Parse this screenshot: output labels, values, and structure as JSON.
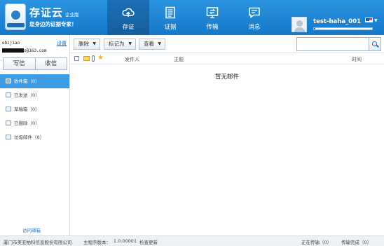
{
  "brand": {
    "name": "存证云",
    "edition": "企业版",
    "slogan": "您身边的证据专家！"
  },
  "nav": [
    {
      "label": "存证",
      "icon": "cloud-upload-icon",
      "active": true
    },
    {
      "label": "证据",
      "icon": "document-icon",
      "active": false
    },
    {
      "label": "传输",
      "icon": "transfer-monitor-icon",
      "active": false
    },
    {
      "label": "消息",
      "icon": "message-icon",
      "active": false
    }
  ],
  "user": {
    "name": "test-haha_001",
    "quota_fraction": 0.03
  },
  "sidebar": {
    "account": "ebijiao",
    "settings_label": "设置",
    "email_suffix": "o@163.com",
    "write_label": "写信",
    "receive_label": "收信",
    "folders": [
      {
        "label": "收件箱（0）",
        "icon": "inbox-icon",
        "active": true
      },
      {
        "label": "已发送（0）",
        "icon": "sent-icon",
        "active": false
      },
      {
        "label": "草稿箱（0）",
        "icon": "draft-icon",
        "active": false
      },
      {
        "label": "已删除（0）",
        "icon": "deleted-icon",
        "active": false
      },
      {
        "label": "垃圾邮件（0）",
        "icon": "trash-icon",
        "active": false
      }
    ],
    "visit_label": "访问邮箱"
  },
  "toolbar": {
    "delete_label": "删除",
    "mark_label": "标记为",
    "view_label": "查看",
    "search_placeholder": ""
  },
  "table": {
    "sender_header": "发件人",
    "subject_header": "主题",
    "time_header": "时间",
    "empty_text": "暂无邮件"
  },
  "status": {
    "company": "厦门市美亚柏科信息股份有限公司",
    "version_label": "主程序版本：",
    "version": "1.0.00001",
    "check_update": "检查更新",
    "uploading": "正在传输（0）",
    "done": "传输完成（0）"
  },
  "colors": {
    "header": "#1a80cf",
    "active_folder": "#3d9be3",
    "link": "#1d6fc0"
  }
}
